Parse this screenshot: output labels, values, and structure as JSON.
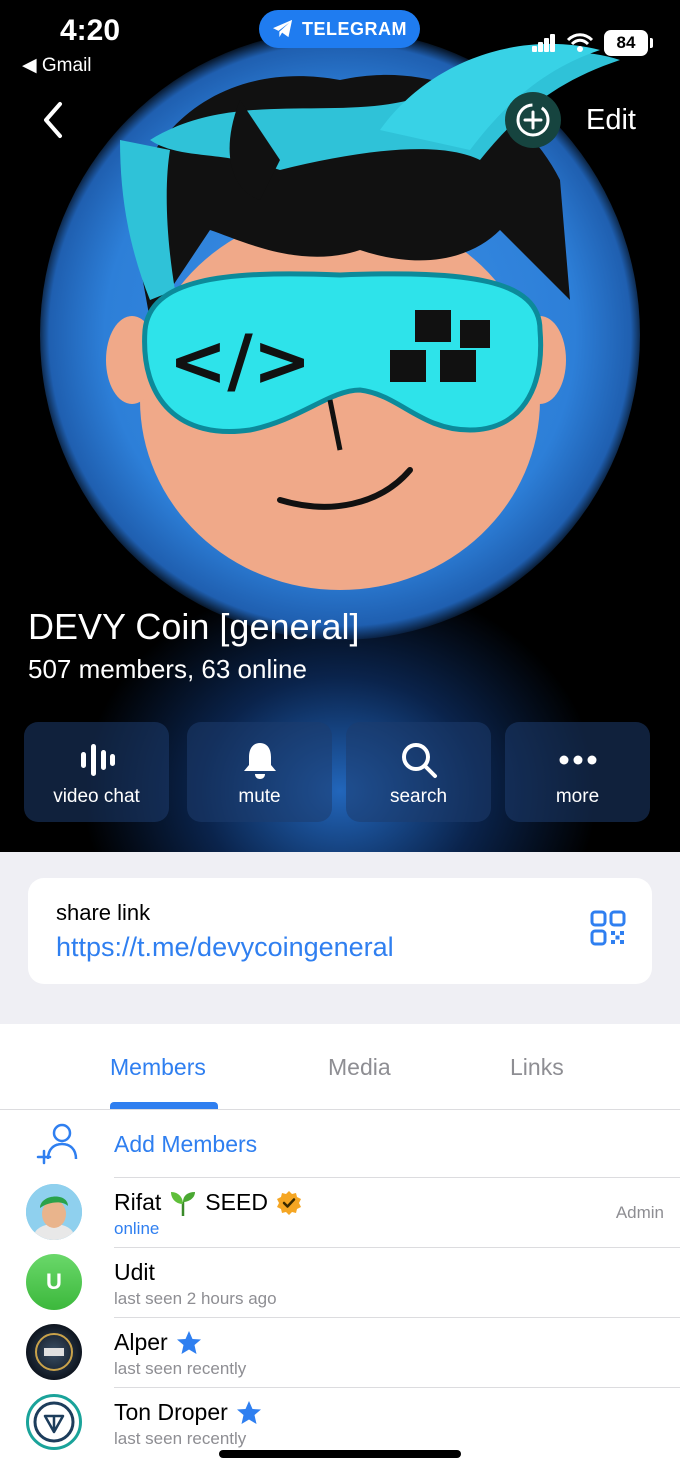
{
  "status_bar": {
    "time": "4:20",
    "back_app": "Gmail",
    "pill": "TELEGRAM",
    "battery": "84"
  },
  "header": {
    "edit_label": "Edit"
  },
  "profile": {
    "title": "DEVY Coin [general]",
    "subtitle": "507 members, 63 online"
  },
  "actions": [
    {
      "label": "video chat",
      "icon": "waveform-icon"
    },
    {
      "label": "mute",
      "icon": "bell-icon"
    },
    {
      "label": "search",
      "icon": "search-icon"
    },
    {
      "label": "more",
      "icon": "more-icon"
    }
  ],
  "share": {
    "label": "share link",
    "url": "https://t.me/devycoingeneral"
  },
  "tabs": [
    {
      "label": "Members",
      "active": true
    },
    {
      "label": "Media",
      "active": false
    },
    {
      "label": "Links",
      "active": false
    }
  ],
  "add_members": {
    "label": "Add Members"
  },
  "members": [
    {
      "name": "Rifat",
      "tag": "SEED",
      "status": "online",
      "role": "Admin",
      "avatar_letter": "",
      "avatar_color": "#7fc7e8"
    },
    {
      "name": "Udit",
      "tag": "",
      "status": "last seen 2 hours ago",
      "role": "",
      "avatar_letter": "U",
      "avatar_color": "#4cc94c"
    },
    {
      "name": "Alper",
      "tag": "",
      "status": "last seen recently",
      "role": "",
      "avatar_letter": "",
      "avatar_color": "#1f2b3a"
    },
    {
      "name": "Ton Droper",
      "tag": "",
      "status": "last seen recently",
      "role": "",
      "avatar_letter": "",
      "avatar_color": "#ffffff"
    }
  ],
  "colors": {
    "accent": "#2f7ff0",
    "secondary_text": "#8e8e93",
    "group_bg": "#efeff4"
  }
}
